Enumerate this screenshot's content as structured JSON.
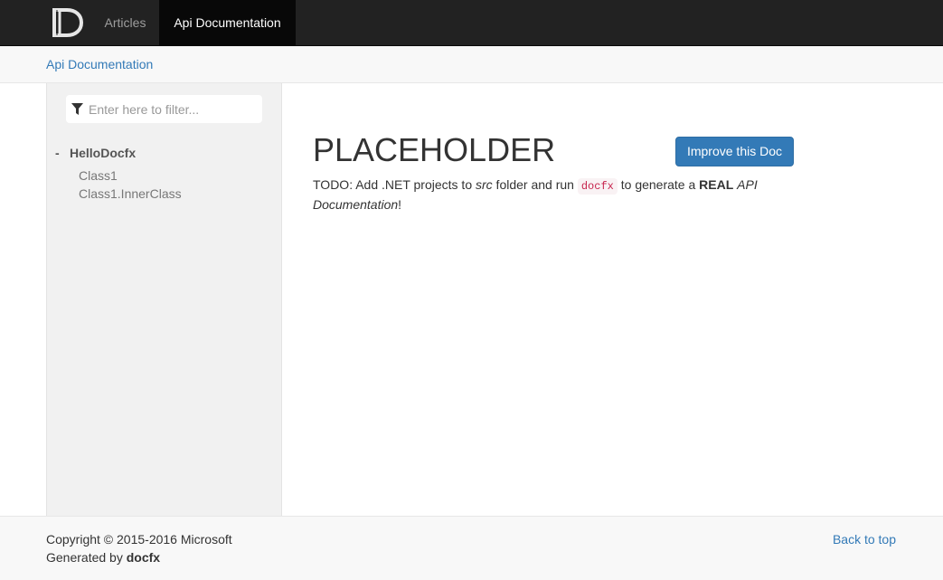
{
  "navbar": {
    "logo_icon": "docfx-logo-icon",
    "items": [
      {
        "label": "Articles",
        "active": false
      },
      {
        "label": "Api Documentation",
        "active": true
      }
    ]
  },
  "breadcrumb": {
    "label": "Api Documentation"
  },
  "sidebar": {
    "filter_placeholder": "Enter here to filter...",
    "filter_icon": "filter-icon",
    "toc": {
      "toggle": "-",
      "label": "HelloDocfx",
      "children": [
        "Class1",
        "Class1.InnerClass"
      ]
    }
  },
  "main": {
    "title": "PLACEHOLDER",
    "improve_button": "Improve this Doc",
    "para": {
      "t1": "TODO: Add .NET projects to ",
      "t2": "src",
      "t3": " folder and run ",
      "code": "docfx",
      "t4": " to generate a ",
      "t5": "REAL",
      "t6": " ",
      "t7": "API Documentation",
      "t8": "!"
    }
  },
  "footer": {
    "copyright": "Copyright © 2015-2016 Microsoft",
    "generated_prefix": "Generated by ",
    "generated_name": "docfx",
    "back_to_top": "Back to top"
  },
  "colors": {
    "navbar": "#222222",
    "active_nav": "#080808",
    "link": "#337ab7",
    "button": "#337ab7",
    "sidebar": "#f1f1f1"
  }
}
